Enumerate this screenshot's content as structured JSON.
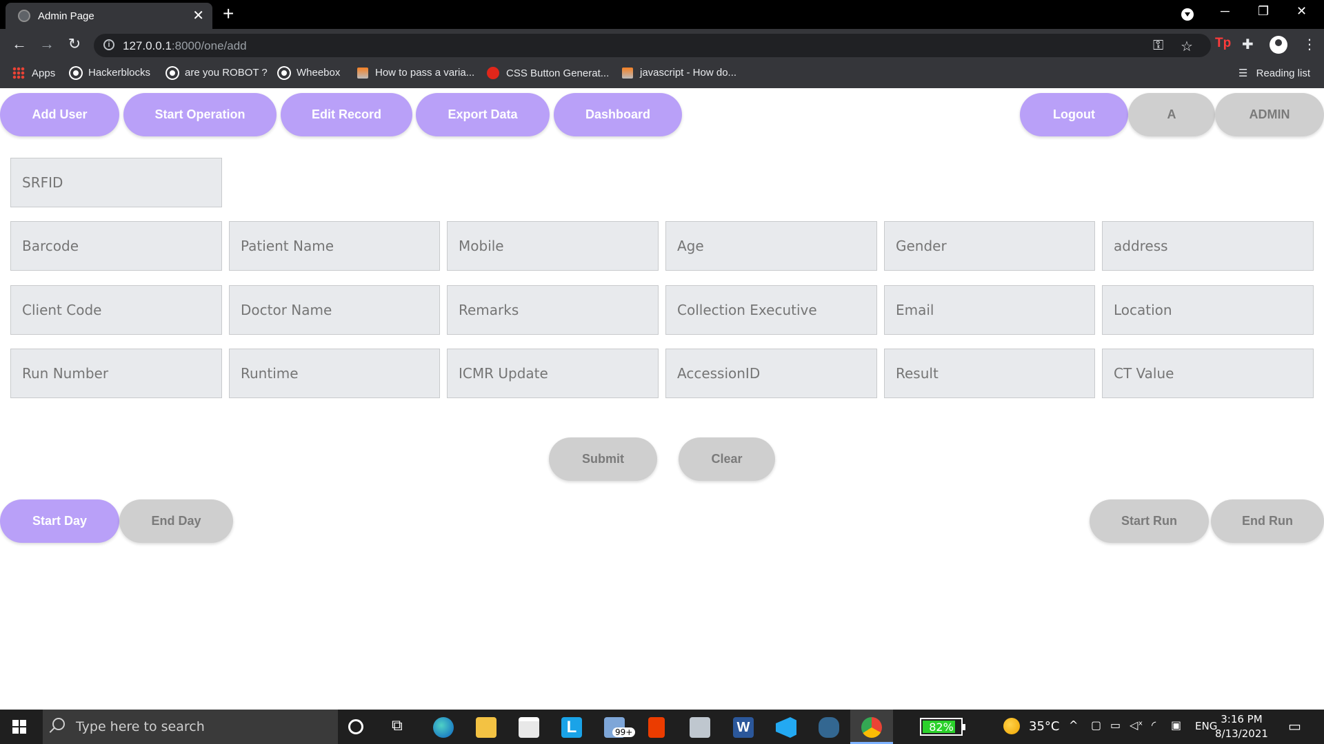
{
  "browser": {
    "tab_title": "Admin Page",
    "tab_close": "✕",
    "new_tab": "+",
    "url_host": "127.0.0.1",
    "url_rest": ":8000/one/add",
    "reading_list": "Reading list",
    "window_controls": [
      "─",
      "❐",
      "✕"
    ]
  },
  "bookmarks": [
    {
      "label": "Apps",
      "icon": "apps-grid-icon"
    },
    {
      "label": "Hackerblocks",
      "icon": "globe-icon"
    },
    {
      "label": "are you ROBOT ?",
      "icon": "globe-icon"
    },
    {
      "label": "Wheebox",
      "icon": "globe-icon"
    },
    {
      "label": "How to pass a varia...",
      "icon": "stackoverflow-icon"
    },
    {
      "label": "CSS Button Generat...",
      "icon": "red-button-icon"
    },
    {
      "label": "javascript - How do...",
      "icon": "stackoverflow-icon"
    }
  ],
  "topnav": {
    "add_user": "Add User",
    "start_operation": "Start Operation",
    "edit_record": "Edit Record",
    "export_data": "Export Data",
    "dashboard": "Dashboard",
    "logout": "Logout",
    "user_initial": "A",
    "user_role": "ADMIN"
  },
  "form": {
    "srfid": "SRFID",
    "row1": [
      "Barcode",
      "Patient Name",
      "Mobile",
      "Age",
      "Gender",
      "address"
    ],
    "row2": [
      "Client Code",
      "Doctor Name",
      "Remarks",
      "Collection Executive",
      "Email",
      "Location"
    ],
    "row3": [
      "Run Number",
      "Runtime",
      "ICMR Update",
      "AccessionID",
      "Result",
      "CT Value"
    ],
    "submit": "Submit",
    "clear": "Clear"
  },
  "bottom": {
    "start_day": "Start Day",
    "end_day": "End Day",
    "start_run": "Start Run",
    "end_run": "End Run"
  },
  "colors": {
    "accent_purple": "#b9a0f8",
    "muted_gray": "#cfcfcf"
  },
  "taskbar": {
    "search_placeholder": "Type here to search",
    "battery": "82%",
    "battery_level": 0.82,
    "weather": "35°C",
    "language": "ENG",
    "time": "3:16 PM",
    "date": "8/13/2021",
    "mail_badge": "99+"
  }
}
